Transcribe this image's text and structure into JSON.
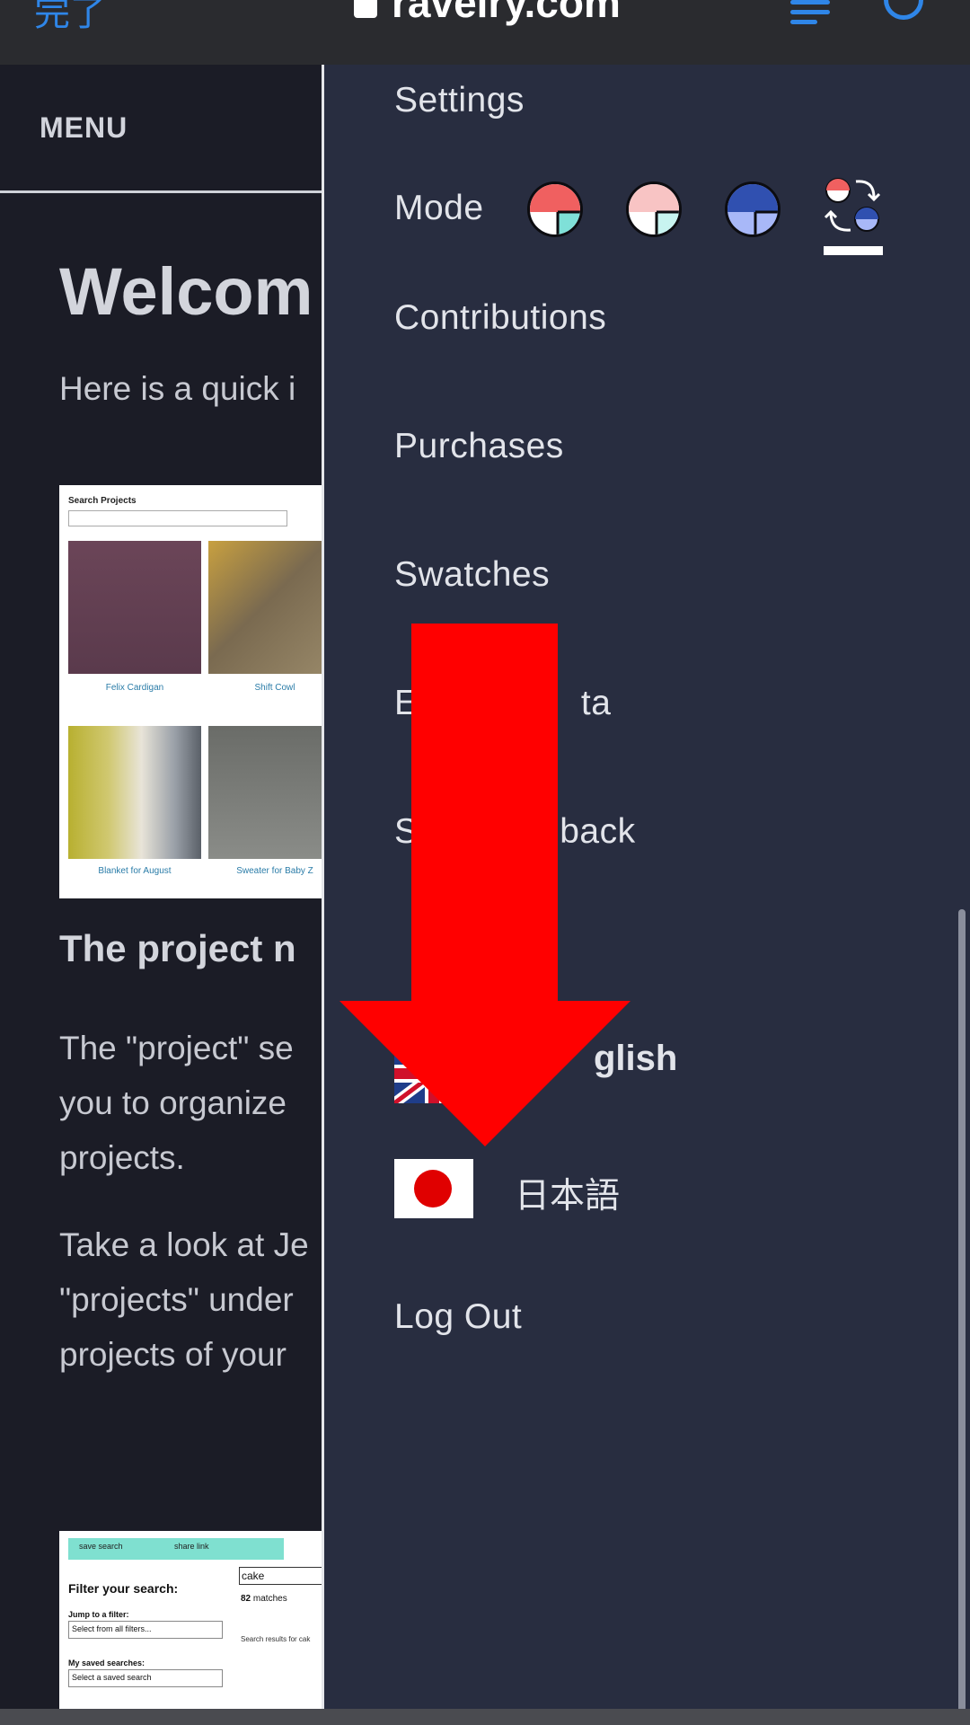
{
  "browser": {
    "done_label": "完了",
    "url": "ravelry.com",
    "menu_icon": "list-icon",
    "refresh_icon": "refresh-icon"
  },
  "page": {
    "menu_label": "MENU",
    "heading": "Welcom",
    "intro": "Here is a quick i",
    "screenshot1": {
      "title": "Search Projects",
      "captions": [
        "Felix Cardigan",
        "Shift Cowl",
        "Blanket for August",
        "Sweater for Baby Z"
      ]
    },
    "subheading": "The project n",
    "para1": [
      "The \"project\" se",
      "you to organize",
      "projects."
    ],
    "para2": [
      "Take a look at Je",
      "\"projects\" under",
      "projects of your"
    ],
    "screenshot2": {
      "save_search": "save search",
      "share_link": "share link",
      "filter_title": "Filter your search:",
      "jump_label": "Jump to a filter:",
      "jump_select": "Select from all filters...",
      "saved_label": "My saved searches:",
      "saved_select": "Select a saved search",
      "query": "cake",
      "matches_count": "82",
      "matches_label": "matches",
      "results_label": "Search results for cak"
    }
  },
  "menu": {
    "settings": "Settings",
    "mode_label": "Mode",
    "mode_options": [
      "red-light-mode-icon",
      "pink-light-mode-icon",
      "blue-dark-mode-icon",
      "auto-mode-icon"
    ],
    "contributions": "Contributions",
    "purchases": "Purchases",
    "swatches": "Swatches",
    "export_data": "E                ta",
    "send_feedback": "S          edback",
    "lang_english": "glish",
    "lang_japanese": "日本語",
    "logout": "Log Out"
  },
  "colors": {
    "panel_bg": "#282d40",
    "page_bg": "#1b1c26",
    "link_blue": "#2f86e8",
    "arrow_red": "#ff0000"
  }
}
